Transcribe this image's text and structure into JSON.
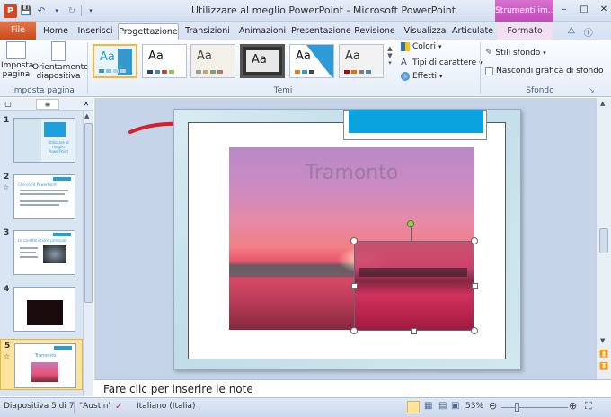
{
  "window": {
    "title": "Utilizzare al meglio PowerPoint  -  Microsoft PowerPoint",
    "context_tab_group": "Strumenti im...",
    "app_icon": "P"
  },
  "tabs": [
    {
      "label": "File"
    },
    {
      "label": "Home"
    },
    {
      "label": "Inserisci"
    },
    {
      "label": "Progettazione"
    },
    {
      "label": "Transizioni"
    },
    {
      "label": "Animazioni"
    },
    {
      "label": "Presentazione"
    },
    {
      "label": "Revisione"
    },
    {
      "label": "Visualizza"
    },
    {
      "label": "Articulate"
    },
    {
      "label": "Formato"
    }
  ],
  "active_tab": "Progettazione",
  "ribbon": {
    "page_setup": {
      "imposta_pagina": "Imposta\npagina",
      "orientamento": "Orientamento\ndiapositiva",
      "group_label": "Imposta pagina"
    },
    "themes": {
      "group_label": "Temi",
      "gallery": [
        {
          "text": "Aa",
          "accent": "#3399cc"
        },
        {
          "text": "Aa",
          "accent": "#1f497d"
        },
        {
          "text": "Aa",
          "accent": "#9c9c9c"
        },
        {
          "text": "Aa",
          "accent": "#5a5a5a"
        },
        {
          "text": "Aa",
          "accent": "#2e9ad8"
        },
        {
          "text": "Aa",
          "accent": "#c00000"
        }
      ],
      "colori": "Colori",
      "tipi_carattere": "Tipi di carattere",
      "effetti": "Effetti"
    },
    "background": {
      "stili_sfondo": "Stili sfondo",
      "nascondi": "Nascondi grafica di sfondo",
      "group_label": "Sfondo"
    }
  },
  "slides_panel": {
    "slides": [
      {
        "number": "1",
        "title": "Utilizzare al meglio PowerPoint",
        "has_star": false
      },
      {
        "number": "2",
        "title": "Che cos'è PowerPoint",
        "has_star": true
      },
      {
        "number": "3",
        "title": "Le caratteristiche principali",
        "has_star": false
      },
      {
        "number": "4",
        "title": "",
        "has_star": false
      },
      {
        "number": "5",
        "title": "Tramonto",
        "has_star": true
      }
    ],
    "selected": "5"
  },
  "slide": {
    "title": "Tramonto"
  },
  "notes": {
    "placeholder": "Fare clic per inserire le note"
  },
  "status": {
    "slide_info": "Diapositiva 5 di 7",
    "theme": "\"Austin\"",
    "language": "Italiano (Italia)",
    "zoom": "53%"
  }
}
